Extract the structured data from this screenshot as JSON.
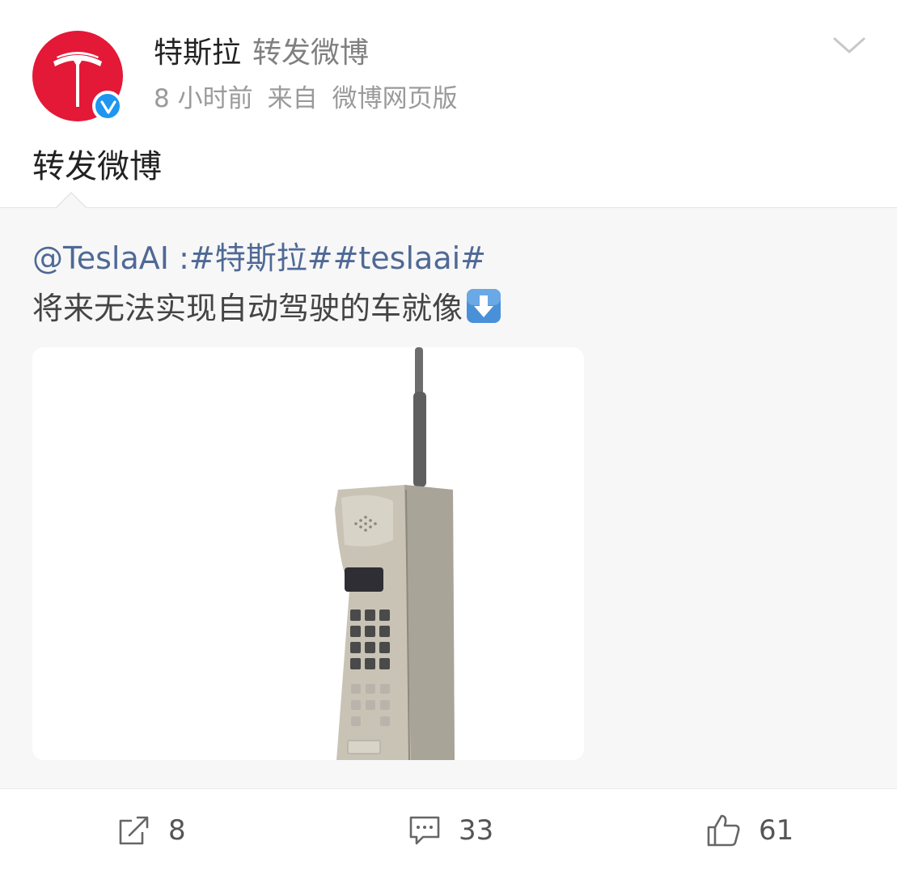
{
  "post": {
    "author": "特斯拉",
    "action": "转发微博",
    "time": "8 小时前",
    "source_prefix": "来自",
    "source": "微博网页版",
    "text": "转发微博"
  },
  "retweet": {
    "mention": "@TeslaAI",
    "separator": " :",
    "hashtag1": "#特斯拉#",
    "hashtag2": "#teslaai#",
    "body": "将来无法实现自动驾驶的车就像",
    "emoji": "down-arrow-emoji"
  },
  "actions": {
    "repost_count": "8",
    "comment_count": "33",
    "like_count": "61"
  },
  "colors": {
    "brand_red": "#e31937",
    "link_blue": "#4f6996",
    "verified_blue": "#1e96f0"
  }
}
